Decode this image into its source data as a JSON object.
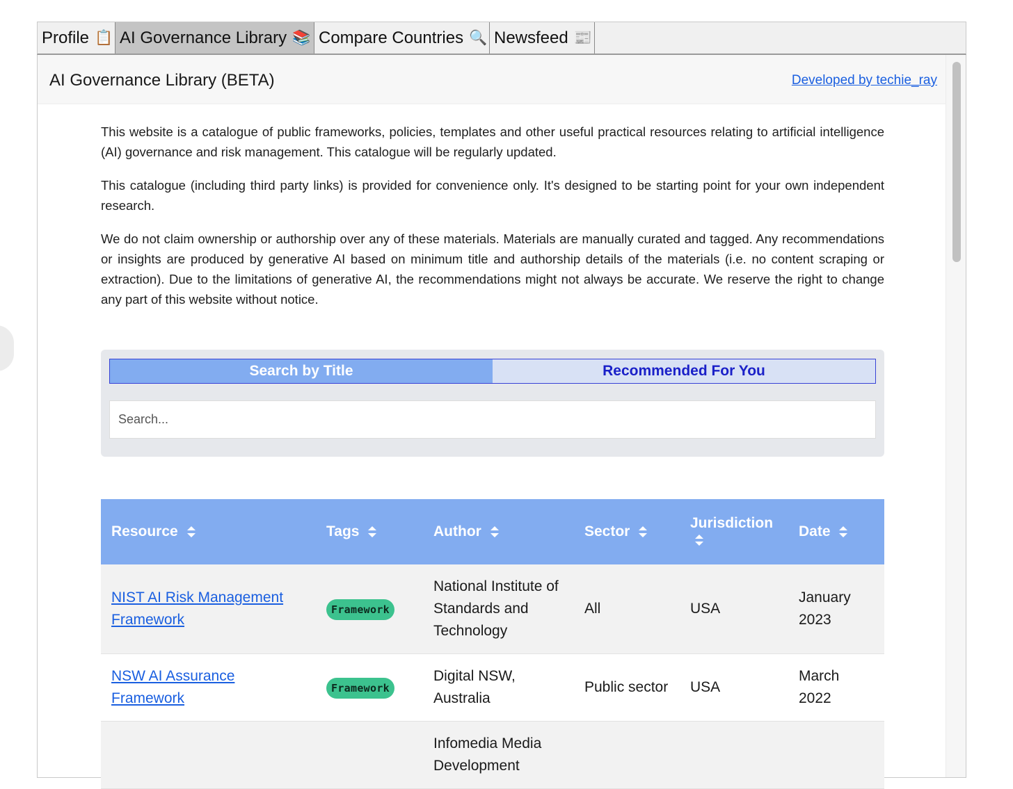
{
  "tabs": [
    {
      "label": "Profile",
      "emoji": "📋",
      "active": false
    },
    {
      "label": "AI Governance Library",
      "emoji": "📚",
      "active": true
    },
    {
      "label": "Compare Countries",
      "emoji": "🔍",
      "active": false
    },
    {
      "label": "Newsfeed",
      "emoji": "📰",
      "active": false
    }
  ],
  "header": {
    "title": "AI Governance Library (BETA)",
    "link": "Developed by techie_ray"
  },
  "intro": {
    "p1": "This website is a catalogue of public frameworks, policies, templates and other useful practical resources relating to artificial intelligence (AI) governance and risk management. This catalogue will be regularly updated.",
    "p2": "This catalogue (including third party links) is provided for convenience only. It's designed to be starting point for your own independent research.",
    "p3": "We do not claim ownership or authorship over any of these materials. Materials are manually curated and tagged. Any recommendations or insights are produced by generative AI based on minimum title and authorship details of the materials (i.e. no content scraping or extraction). Due to the limitations of generative AI, the recommendations might not always be accurate. We reserve the right to change any part of this website without notice."
  },
  "search": {
    "mode_title": "Search by Title",
    "mode_recommended": "Recommended For You",
    "placeholder": "Search..."
  },
  "table": {
    "headers": {
      "resource": "Resource",
      "tags": "Tags",
      "author": "Author",
      "sector": "Sector",
      "jurisdiction": "Jurisdiction",
      "date": "Date"
    },
    "rows": [
      {
        "resource": "NIST AI Risk Management Framework",
        "tag": "Framework",
        "author": "National Institute of Standards and Technology",
        "sector": "All",
        "jurisdiction": "USA",
        "date": "January 2023"
      },
      {
        "resource": "NSW AI Assurance Framework",
        "tag": "Framework",
        "author": "Digital NSW, Australia",
        "sector": "Public sector",
        "jurisdiction": "USA",
        "date": "March 2022"
      },
      {
        "resource": "",
        "tag": "",
        "author": "Infomedia Media Development",
        "sector": "",
        "jurisdiction": "",
        "date": ""
      }
    ]
  },
  "colors": {
    "accent_blue": "#82acf0",
    "tag_green": "#3cc28e",
    "link_blue": "#1a5fe0",
    "active_text": "#1a20c8"
  }
}
